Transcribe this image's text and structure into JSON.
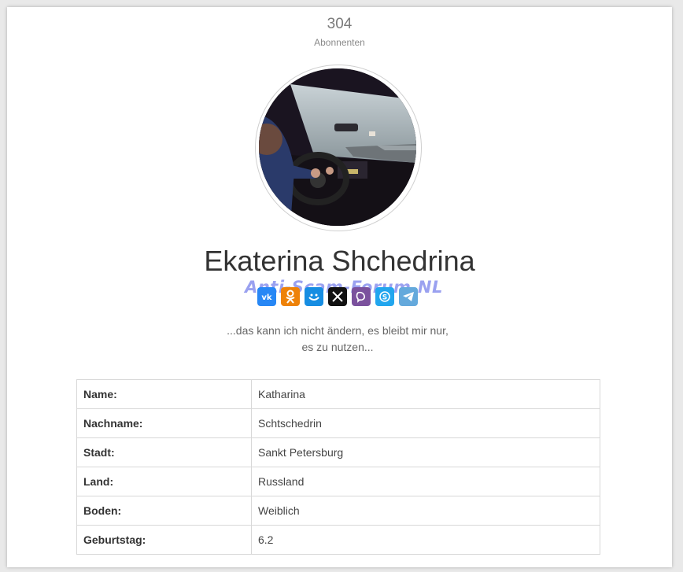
{
  "subscribers": {
    "count": "304",
    "label": "Abonnenten"
  },
  "profile": {
    "name": "Ekaterina Shchedrina",
    "status": "...das kann ich nicht ändern, es bleibt mir nur, es zu nutzen..."
  },
  "watermark": "Anti-Scam-Forum.NL",
  "social": [
    {
      "name": "vk-icon",
      "glyph": "vk",
      "color": "#2787f5"
    },
    {
      "name": "odnoklassniki-icon",
      "glyph": "ok",
      "color": "#ee8208"
    },
    {
      "name": "mailru-icon",
      "glyph": "mail",
      "color": "#168de2"
    },
    {
      "name": "x-twitter-icon",
      "glyph": "X",
      "color": "#111111"
    },
    {
      "name": "viber-icon",
      "glyph": "viber",
      "color": "#7b519d"
    },
    {
      "name": "skype-icon",
      "glyph": "S",
      "color": "#22a6ee"
    },
    {
      "name": "telegram-icon",
      "glyph": "tg",
      "color": "#64a9dc"
    }
  ],
  "info": [
    {
      "key": "Name:",
      "value": "Katharina"
    },
    {
      "key": "Nachname:",
      "value": "Schtschedrin"
    },
    {
      "key": "Stadt:",
      "value": "Sankt Petersburg"
    },
    {
      "key": "Land:",
      "value": "Russland"
    },
    {
      "key": "Boden:",
      "value": "Weiblich"
    },
    {
      "key": "Geburtstag:",
      "value": "6.2"
    }
  ]
}
